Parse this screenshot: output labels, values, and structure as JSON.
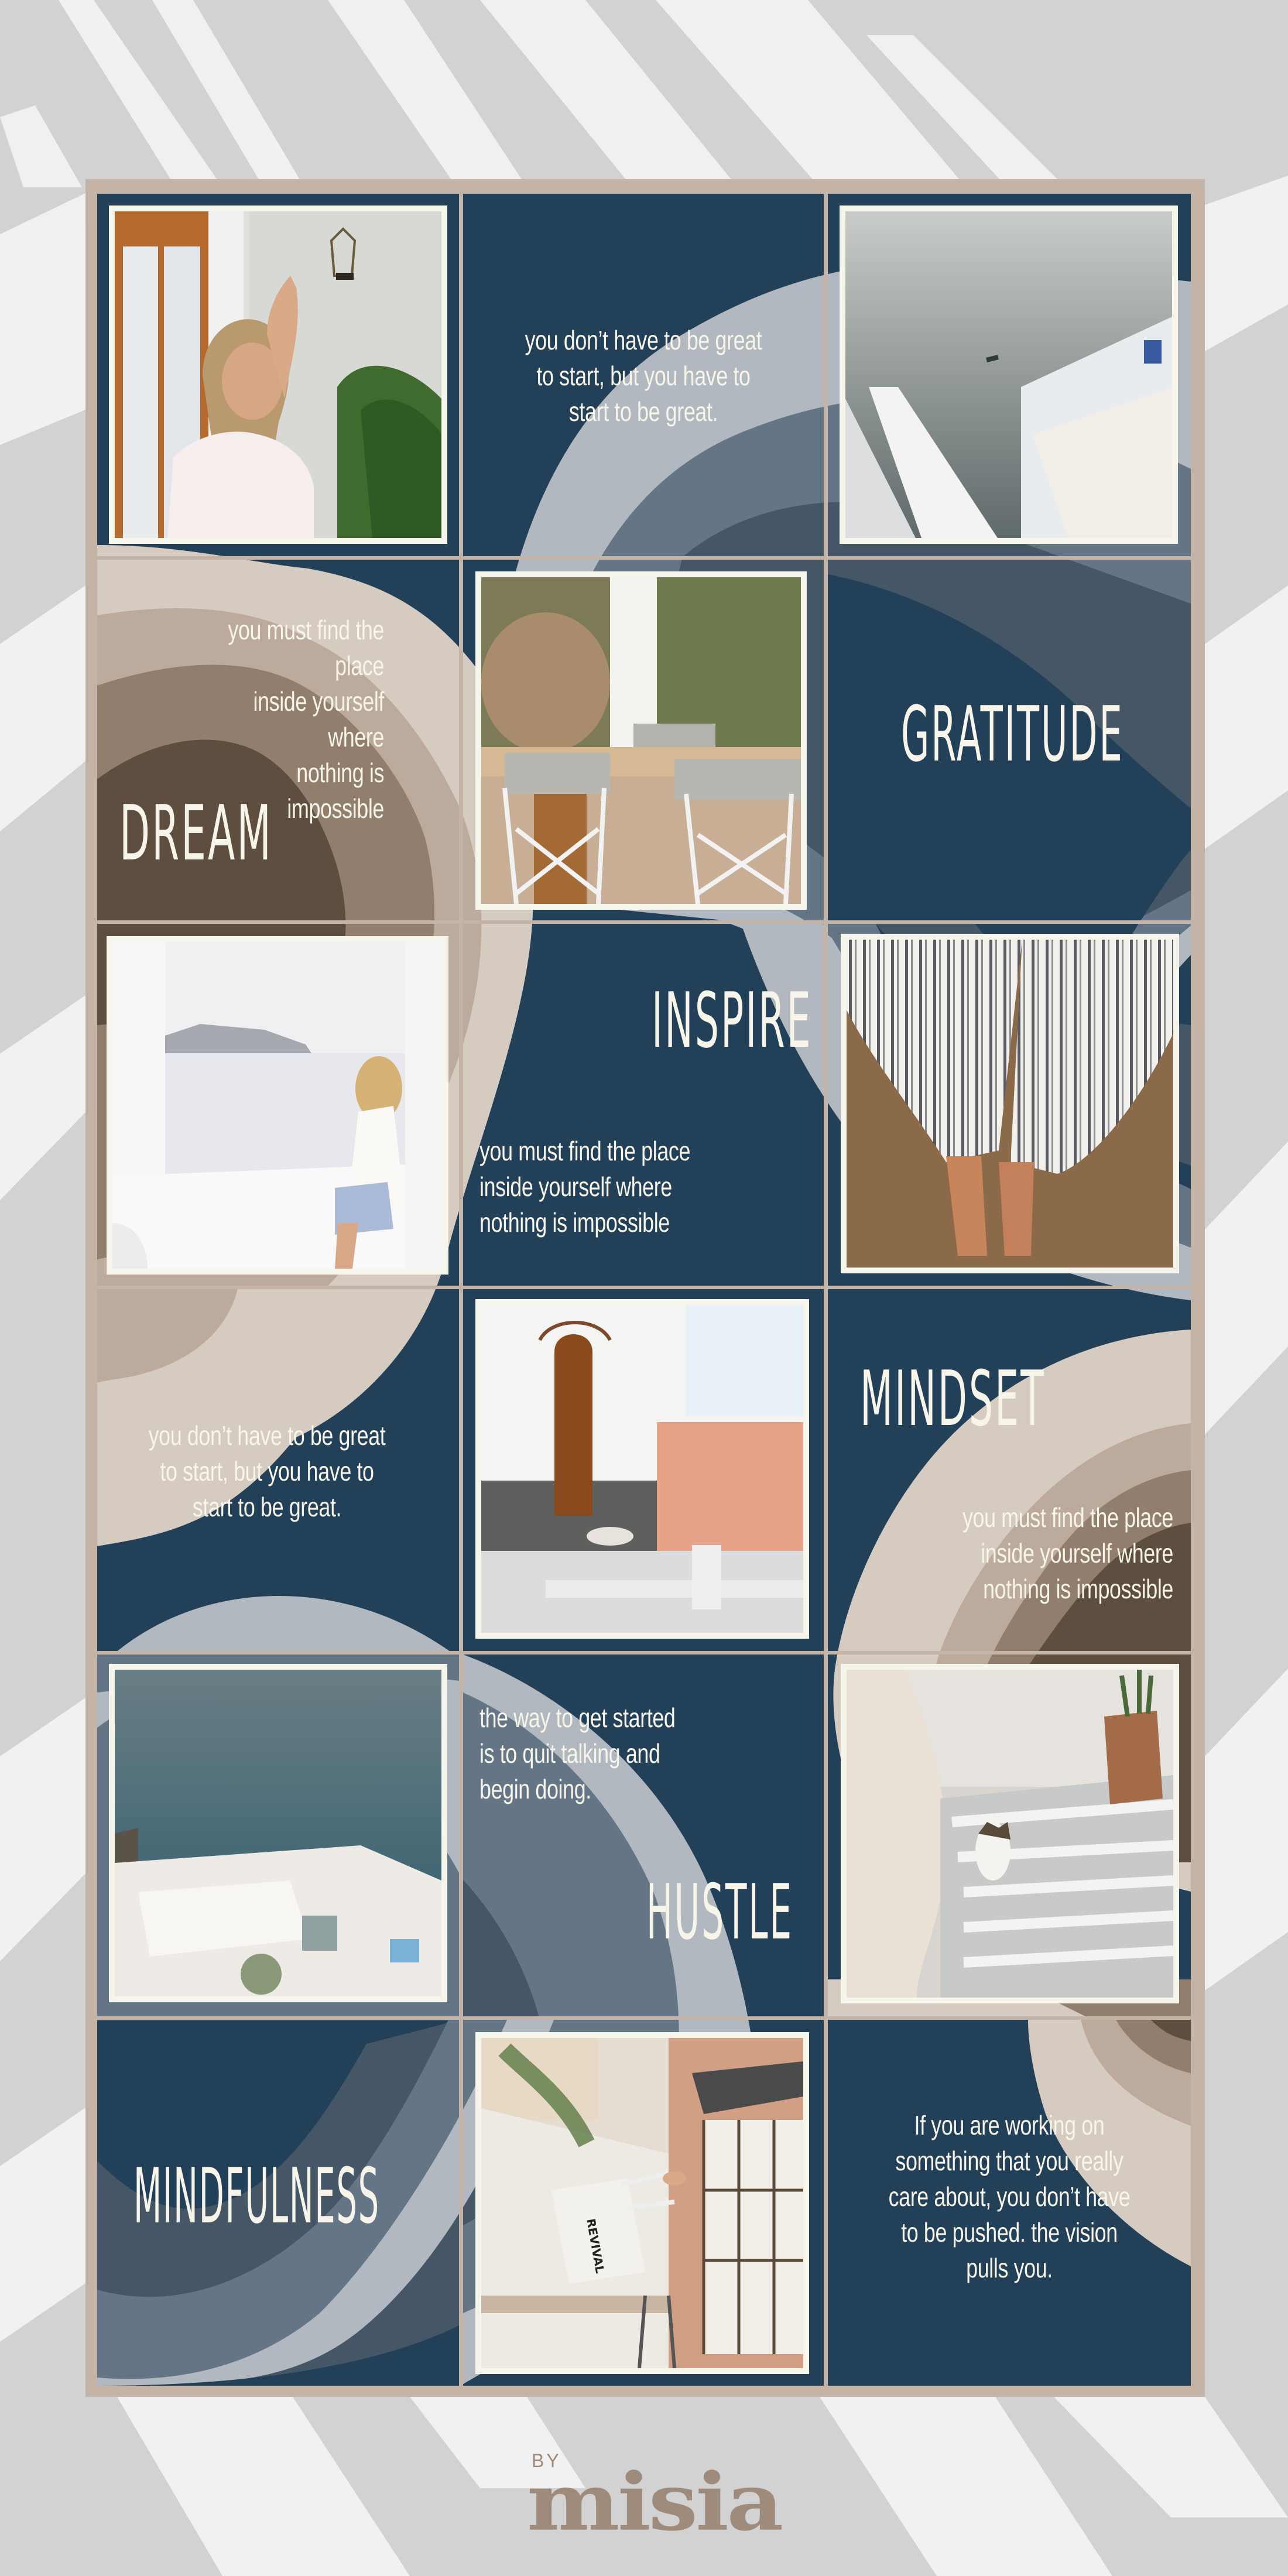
{
  "colors": {
    "navy": "#234059",
    "slate_dark": "#455667",
    "slate": "#647685",
    "slate_light": "#b2b8bf",
    "beige_light": "#d5cbc1",
    "beige_mid": "#bcab9c",
    "taupe": "#927e6c",
    "brown": "#5d4e40",
    "frame": "#c4b4a8",
    "text_cream": "#f7f5ea",
    "photo_border": "#f6f5ec",
    "logo": "#9e8b7b"
  },
  "tiles": [
    {
      "row": 1,
      "col": 1,
      "type": "photo",
      "subject": "woman in white shirt with lantern and plants"
    },
    {
      "row": 1,
      "col": 2,
      "type": "quote",
      "quote": "you don’t have to be great\nto start, but you have to\nstart to be great."
    },
    {
      "row": 1,
      "col": 3,
      "type": "photo",
      "subject": "sea view with white terrace and boat"
    },
    {
      "row": 2,
      "col": 1,
      "type": "quote-headline",
      "quote": "you must find the place\ninside yourself where\nnothing is impossible",
      "headline": "DREAM"
    },
    {
      "row": 2,
      "col": 2,
      "type": "photo",
      "subject": "wooden table with director chairs"
    },
    {
      "row": 2,
      "col": 3,
      "type": "headline",
      "headline": "GRATITUDE"
    },
    {
      "row": 3,
      "col": 1,
      "type": "photo",
      "subject": "woman with straw hat sitting by window overlooking sea"
    },
    {
      "row": 3,
      "col": 2,
      "type": "quote-headline",
      "headline": "INSPIRE",
      "quote": "you must find the place\ninside yourself where\nnothing is impossible"
    },
    {
      "row": 3,
      "col": 3,
      "type": "photo",
      "subject": "bare feet and striped trousers on sand"
    },
    {
      "row": 4,
      "col": 1,
      "type": "quote",
      "quote": "you don’t have to be great\nto start, but you have to\nstart to be great."
    },
    {
      "row": 4,
      "col": 2,
      "type": "photo",
      "subject": "arched wooden door, pink wall and sleeping dog"
    },
    {
      "row": 4,
      "col": 3,
      "type": "quote-headline",
      "headline": "MINDSET",
      "quote": "you must find the place\ninside yourself where\nnothing is impossible"
    },
    {
      "row": 5,
      "col": 1,
      "type": "photo",
      "subject": "aerial sea view with boats and white buildings"
    },
    {
      "row": 5,
      "col": 2,
      "type": "quote-headline",
      "quote": "the way to get started\nis to quit talking and\nbegin doing.",
      "headline": "HUSTLE"
    },
    {
      "row": 5,
      "col": 3,
      "type": "photo",
      "subject": "cat on white stone steps with pot"
    },
    {
      "row": 6,
      "col": 1,
      "type": "headline",
      "headline": "MINDFULNESS"
    },
    {
      "row": 6,
      "col": 2,
      "type": "photo",
      "subject": "tote bag held outside brick cafe",
      "bag_text": "REVIVAL"
    },
    {
      "row": 6,
      "col": 3,
      "type": "quote",
      "quote": "If you are working on\nsomething that you really\ncare about, you don’t have\nto be pushed. the vision\npulls you."
    }
  ],
  "logo": {
    "by": "BY",
    "name": "misia"
  }
}
